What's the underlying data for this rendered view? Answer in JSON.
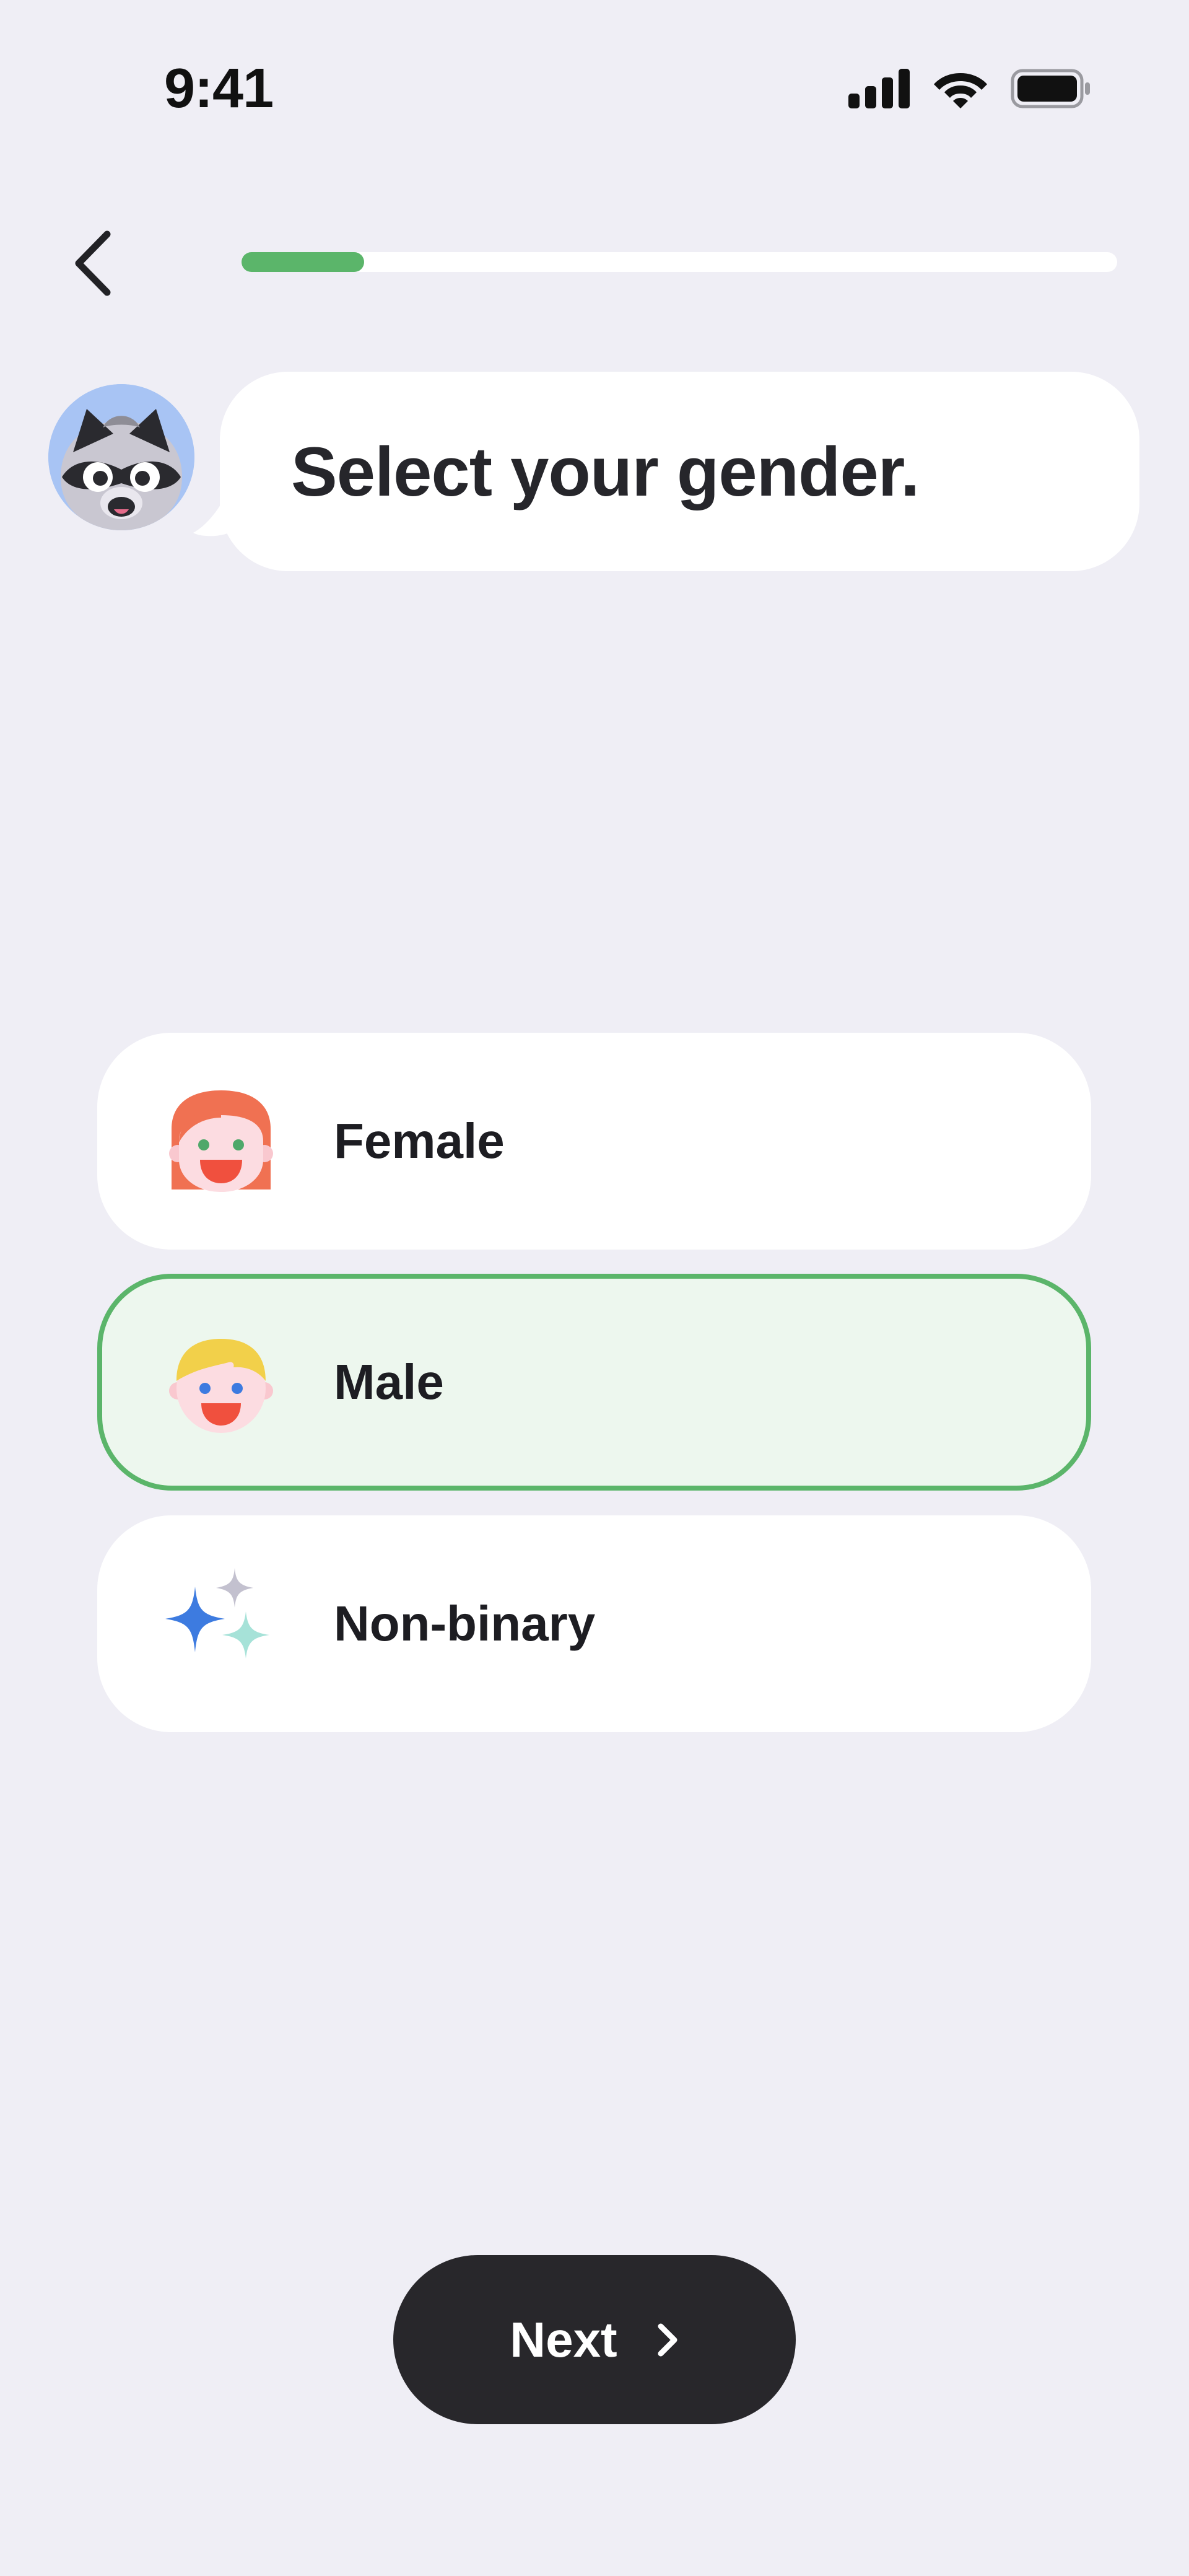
{
  "status_bar": {
    "time": "9:41",
    "icons": [
      "cellular-signal-icon",
      "wifi-icon",
      "battery-icon"
    ]
  },
  "nav": {
    "back_icon": "chevron-left-icon",
    "progress": 0.14
  },
  "prompt": {
    "mascot": "raccoon-mascot",
    "question": "Select your gender."
  },
  "options": [
    {
      "label": "Female",
      "icon": "female-face-icon",
      "selected": false
    },
    {
      "label": "Male",
      "icon": "male-face-icon",
      "selected": true
    },
    {
      "label": "Non-binary",
      "icon": "sparkles-icon",
      "selected": false
    }
  ],
  "footer": {
    "next_label": "Next",
    "next_icon": "chevron-right-icon"
  },
  "colors": {
    "background": "#EFEEF5",
    "accent_green": "#5BB56A",
    "selected_fill": "#EDF7EE",
    "button_dark": "#28272B"
  }
}
